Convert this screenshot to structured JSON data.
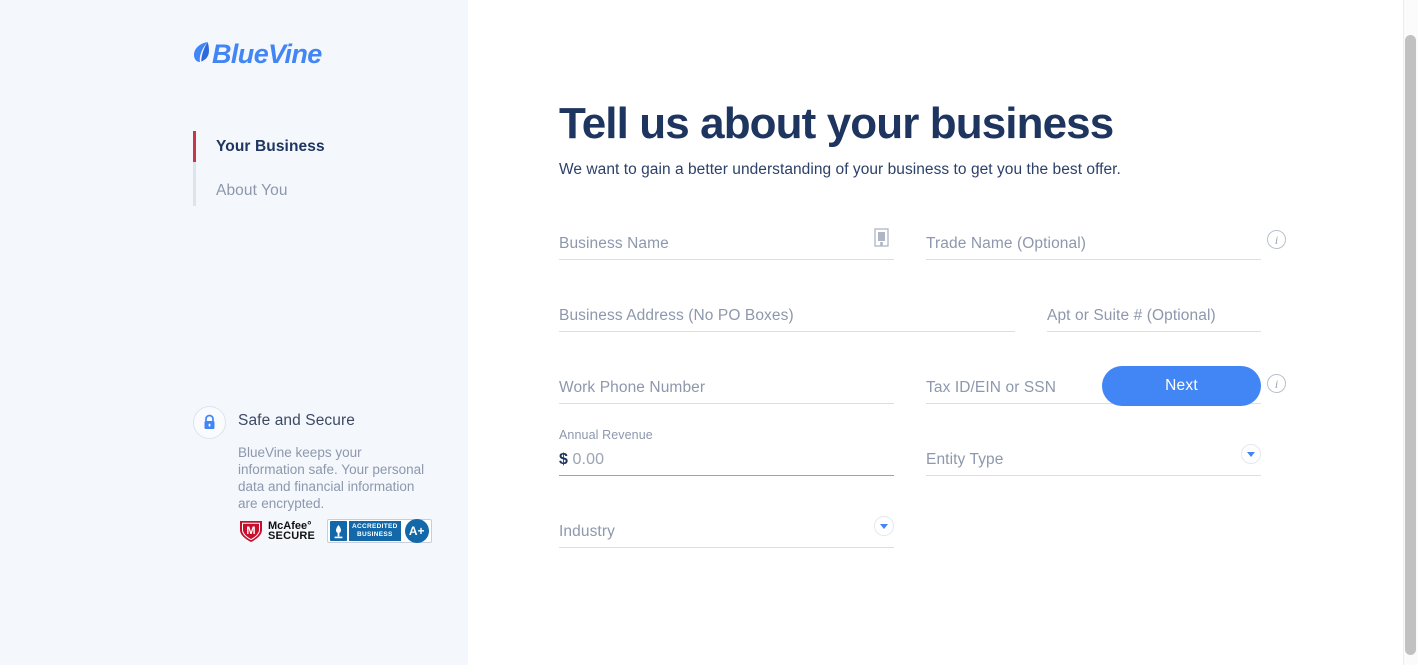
{
  "brand": {
    "name": "BlueVine",
    "logo_color": "#4285f4",
    "accent_color": "#4285f4",
    "active_nav_color": "#c8344a",
    "heading_color": "#1e3560"
  },
  "sidebar": {
    "nav": [
      {
        "label": "Your Business",
        "active": true
      },
      {
        "label": "About You",
        "active": false
      }
    ],
    "secure": {
      "icon": "lock-icon",
      "title": "Safe and Secure",
      "body": "BlueVine keeps your information safe. Your personal data and financial information are encrypted."
    },
    "badges": {
      "mcafee": {
        "line1": "McAfee°",
        "line2": "SECURE"
      },
      "bbb": {
        "line1": "ACCREDITED",
        "line2": "BUSINESS",
        "rating": "A+"
      }
    }
  },
  "main": {
    "title": "Tell us about your business",
    "subtitle": "We want to gain a better understanding of your business to get you the best offer.",
    "fields": {
      "business_name": {
        "placeholder": "Business Name",
        "value": "",
        "trailing_icon": "building-icon"
      },
      "trade_name": {
        "placeholder": "Trade Name (Optional)",
        "value": "",
        "trailing_icon": "info-icon"
      },
      "business_address": {
        "placeholder": "Business Address (No PO Boxes)",
        "value": ""
      },
      "apt_suite": {
        "placeholder": "Apt or Suite # (Optional)",
        "value": ""
      },
      "work_phone": {
        "placeholder": "Work Phone Number",
        "value": ""
      },
      "tax_id": {
        "placeholder": "Tax ID/EIN or SSN",
        "value": "",
        "trailing_icon": "info-icon"
      },
      "annual_revenue": {
        "label": "Annual Revenue",
        "currency": "$",
        "value": "0.00"
      },
      "entity_type": {
        "placeholder": "Entity Type",
        "value": "",
        "trailing_icon": "chevron-down-icon"
      },
      "industry": {
        "placeholder": "Industry",
        "value": "",
        "trailing_icon": "chevron-down-icon"
      }
    },
    "next_label": "Next"
  }
}
